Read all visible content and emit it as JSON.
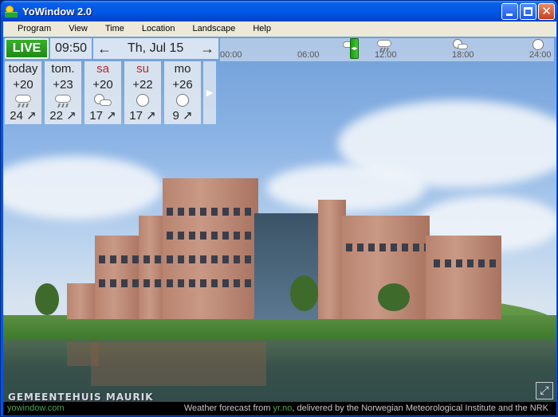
{
  "window": {
    "title": "YoWindow 2.0"
  },
  "menu": {
    "items": [
      "Program",
      "View",
      "Time",
      "Location",
      "Landscape",
      "Help"
    ]
  },
  "controls": {
    "live_label": "LIVE",
    "time": "09:50",
    "date": "Th, Jul 15",
    "prev_arrow": "←",
    "next_arrow": "→"
  },
  "timeline": {
    "ticks": [
      "00:00",
      "06:00",
      "12:00",
      "18:00",
      "24:00"
    ],
    "icons": [
      "partly-cloudy-icon",
      "rain-cloud-icon",
      "partly-cloudy-icon",
      "sun-icon"
    ],
    "current_position": 0.4
  },
  "forecast": [
    {
      "day": "today",
      "temp": "+20",
      "icon": "rain-cloud-icon",
      "wind": "24 ↗",
      "weekend": false
    },
    {
      "day": "tom.",
      "temp": "+23",
      "icon": "rain-cloud-icon",
      "wind": "22 ↗",
      "weekend": false
    },
    {
      "day": "sa",
      "temp": "+20",
      "icon": "partly-cloudy-icon",
      "wind": "17 ↗",
      "weekend": true
    },
    {
      "day": "su",
      "temp": "+22",
      "icon": "sun-icon",
      "wind": "17 ↗",
      "weekend": true
    },
    {
      "day": "mo",
      "temp": "+26",
      "icon": "sun-icon",
      "wind": "9 ↗",
      "weekend": false
    }
  ],
  "forecast_more_icon": "▶",
  "location_name": "GEMEENTEHUIS MAURIK",
  "fullscreen_icon": "⤢",
  "status": {
    "site": "yowindow.com",
    "credit_prefix": "Weather forecast from ",
    "credit_link": "yr.no",
    "credit_suffix": ", delivered by the Norwegian Meteorological Institute and the NRK"
  },
  "colors": {
    "live_green": "#2a9e20",
    "weekend_red": "#b32a2a",
    "status_green": "#4fa04a"
  }
}
